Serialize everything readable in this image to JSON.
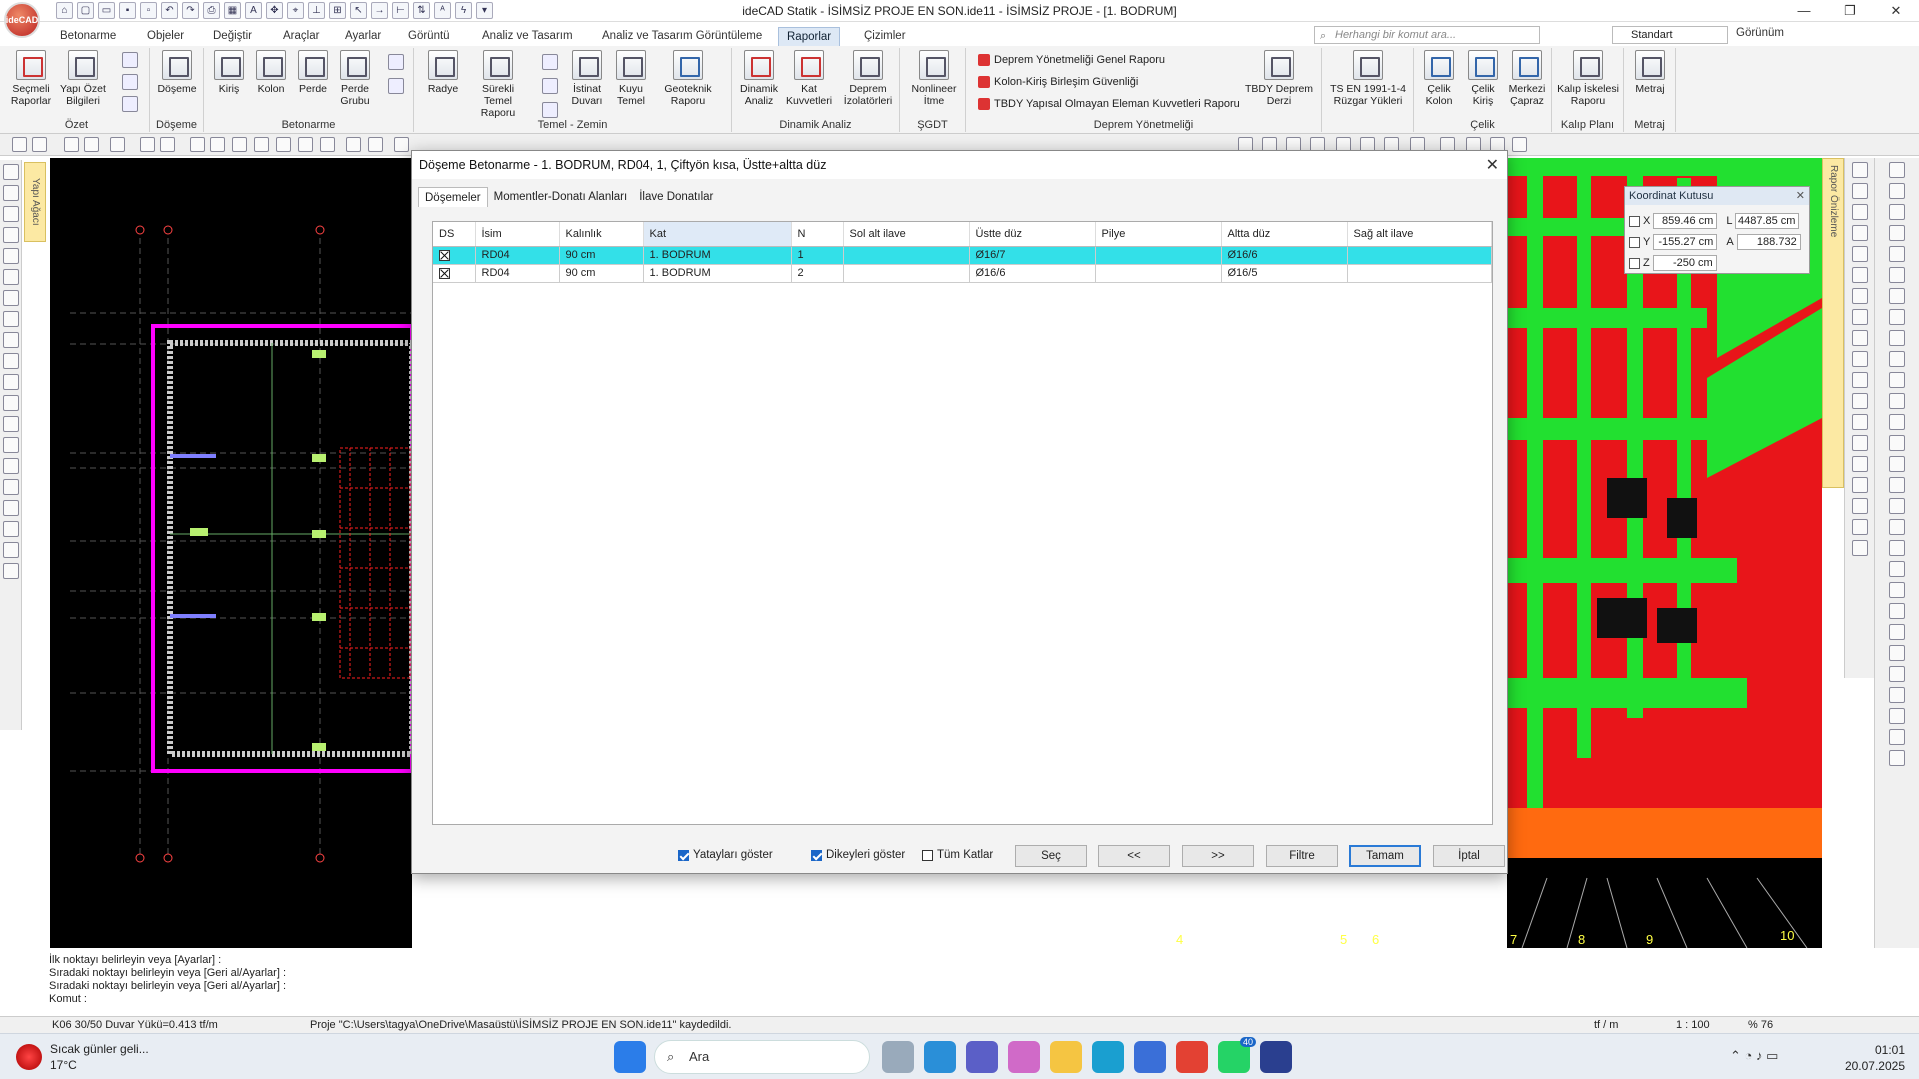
{
  "app": {
    "logo_text": "ideCAD",
    "window_title": "ideCAD Statik - İSİMSİZ PROJE EN SON.ide11 - İSİMSİZ PROJE - [1. BODRUM]"
  },
  "menu_tabs": [
    "Betonarme",
    "Objeler",
    "Değiştir",
    "Araçlar",
    "Ayarlar",
    "Görüntü",
    "Analiz ve Tasarım",
    "Analiz ve Tasarım Görüntüleme",
    "Raporlar",
    "Çizimler"
  ],
  "active_tab": "Raporlar",
  "search": {
    "placeholder": "Herhangi bir komut ara..."
  },
  "view_select": {
    "value": "Standart"
  },
  "view_menu": "Görünüm",
  "ribbon": {
    "ozet": {
      "label": "Özet",
      "b1": "Seçmeli Raporlar",
      "b2": "Yapı Özet Bilgileri"
    },
    "doseme": {
      "label": "Döşeme",
      "b1": "Döşeme"
    },
    "betonarme": {
      "label": "Betonarme",
      "b1": "Kiriş",
      "b2": "Kolon",
      "b3": "Perde",
      "b4": "Perde Grubu"
    },
    "temel": {
      "label": "Temel - Zemin",
      "b1": "Radye",
      "b2": "Sürekli Temel Raporu",
      "b3": "İstinat Duvarı",
      "b4": "Kuyu Temel",
      "b5": "Geoteknik Raporu"
    },
    "dinamik": {
      "label": "Dinamik Analiz",
      "b1": "Dinamik Analiz",
      "b2": "Kat Kuvvetleri",
      "b3": "Deprem İzolatörleri"
    },
    "sgdt": {
      "label": "ŞGDT",
      "b1": "Nonlineer İtme"
    },
    "deprem": {
      "label": "Deprem Yönetmeliği",
      "l1": "Deprem Yönetmeliği Genel Raporu",
      "l2": "Kolon-Kiriş Birleşim Güvenliği",
      "l3": "TBDY Yapısal Olmayan Eleman Kuvvetleri Raporu",
      "b1": "TBDY Deprem Derzi"
    },
    "ruzgar": {
      "b1": "TS EN 1991-1-4 Rüzgar Yükleri"
    },
    "celik": {
      "label": "Çelik",
      "b1": "Çelik Kolon",
      "b2": "Çelik Kiriş",
      "b3": "Merkezi Çapraz"
    },
    "kalip": {
      "label": "Kalıp Planı",
      "b1": "Kalıp İskelesi Raporu"
    },
    "metraj": {
      "label": "Metraj",
      "b1": "Metraj"
    }
  },
  "side_panels": {
    "left": "Yapı Ağacı",
    "right": "Rapor Önizleme"
  },
  "coord_box": {
    "title": "Koordinat Kutusu",
    "x_label": "X",
    "x_value": "859.46 cm",
    "y_label": "Y",
    "y_value": "-155.27 cm",
    "z_label": "Z",
    "z_value": "-250 cm",
    "l_label": "L",
    "l_value": "4487.85 cm",
    "a_label": "A",
    "a_value": "188.732"
  },
  "axis_labels": {
    "bottom": [
      "4",
      "5",
      "6",
      "7",
      "8",
      "9",
      "10"
    ]
  },
  "dialog": {
    "title": "Döşeme Betonarme - 1. BODRUM, RD04, 1, Çiftyön kısa, Üstte+altta düz",
    "tabs": [
      "Döşemeler",
      "Momentler-Donatı Alanları",
      "İlave Donatılar"
    ],
    "active_tab": "Döşemeler",
    "columns": [
      "DS",
      "İsim",
      "Kalınlık",
      "Kat",
      "N",
      "Sol alt ilave",
      "Üstte düz",
      "Pilye",
      "Altta düz",
      "Sağ alt ilave"
    ],
    "rows": [
      {
        "isim": "RD04",
        "kalinlik": "90 cm",
        "kat": "1. BODRUM",
        "n": "1",
        "sol_alt": "",
        "ustte": "Ø16/7",
        "pilye": "",
        "altta": "Ø16/6",
        "sag_alt": "",
        "selected": true
      },
      {
        "isim": "RD04",
        "kalinlik": "90 cm",
        "kat": "1. BODRUM",
        "n": "2",
        "sol_alt": "",
        "ustte": "Ø16/6",
        "pilye": "",
        "altta": "Ø16/5",
        "sag_alt": "",
        "selected": false
      }
    ],
    "footer": {
      "show_horizontal": "Yatayları göster",
      "show_vertical": "Dikeyleri göster",
      "all_floors": "Tüm Katlar",
      "select": "Seç",
      "prev": "<<",
      "next": ">>",
      "filter": "Filtre",
      "ok": "Tamam",
      "cancel": "İptal"
    }
  },
  "command_lines": [
    "İlk noktayı belirleyin veya [Ayarlar] :",
    "Sıradaki noktayı belirleyin veya [Geri al/Ayarlar] :",
    "Sıradaki noktayı belirleyin veya [Geri al/Ayarlar] :",
    "Komut :"
  ],
  "status": {
    "left": "K06 30/50 Duvar Yükü=0.413 tf/m",
    "message": "Proje \"C:\\Users\\tagya\\OneDrive\\Masaüstü\\İSİMSİZ PROJE EN SON.ide11\" kaydedildi.",
    "unit": "tf / m",
    "scale": "1 : 100",
    "zoom": "% 76"
  },
  "taskbar": {
    "weather_title": "Sıcak günler geli...",
    "weather_temp": "17°C",
    "search": "Ara",
    "badge": "40",
    "time": "01:01",
    "date": "20.07.2025"
  },
  "colors": {
    "accent": "#1a66c8",
    "selection": "#33e0e8",
    "slab_outline": "#ff00ff",
    "beam_green": "#22e030",
    "beam_red": "#e8151a"
  }
}
